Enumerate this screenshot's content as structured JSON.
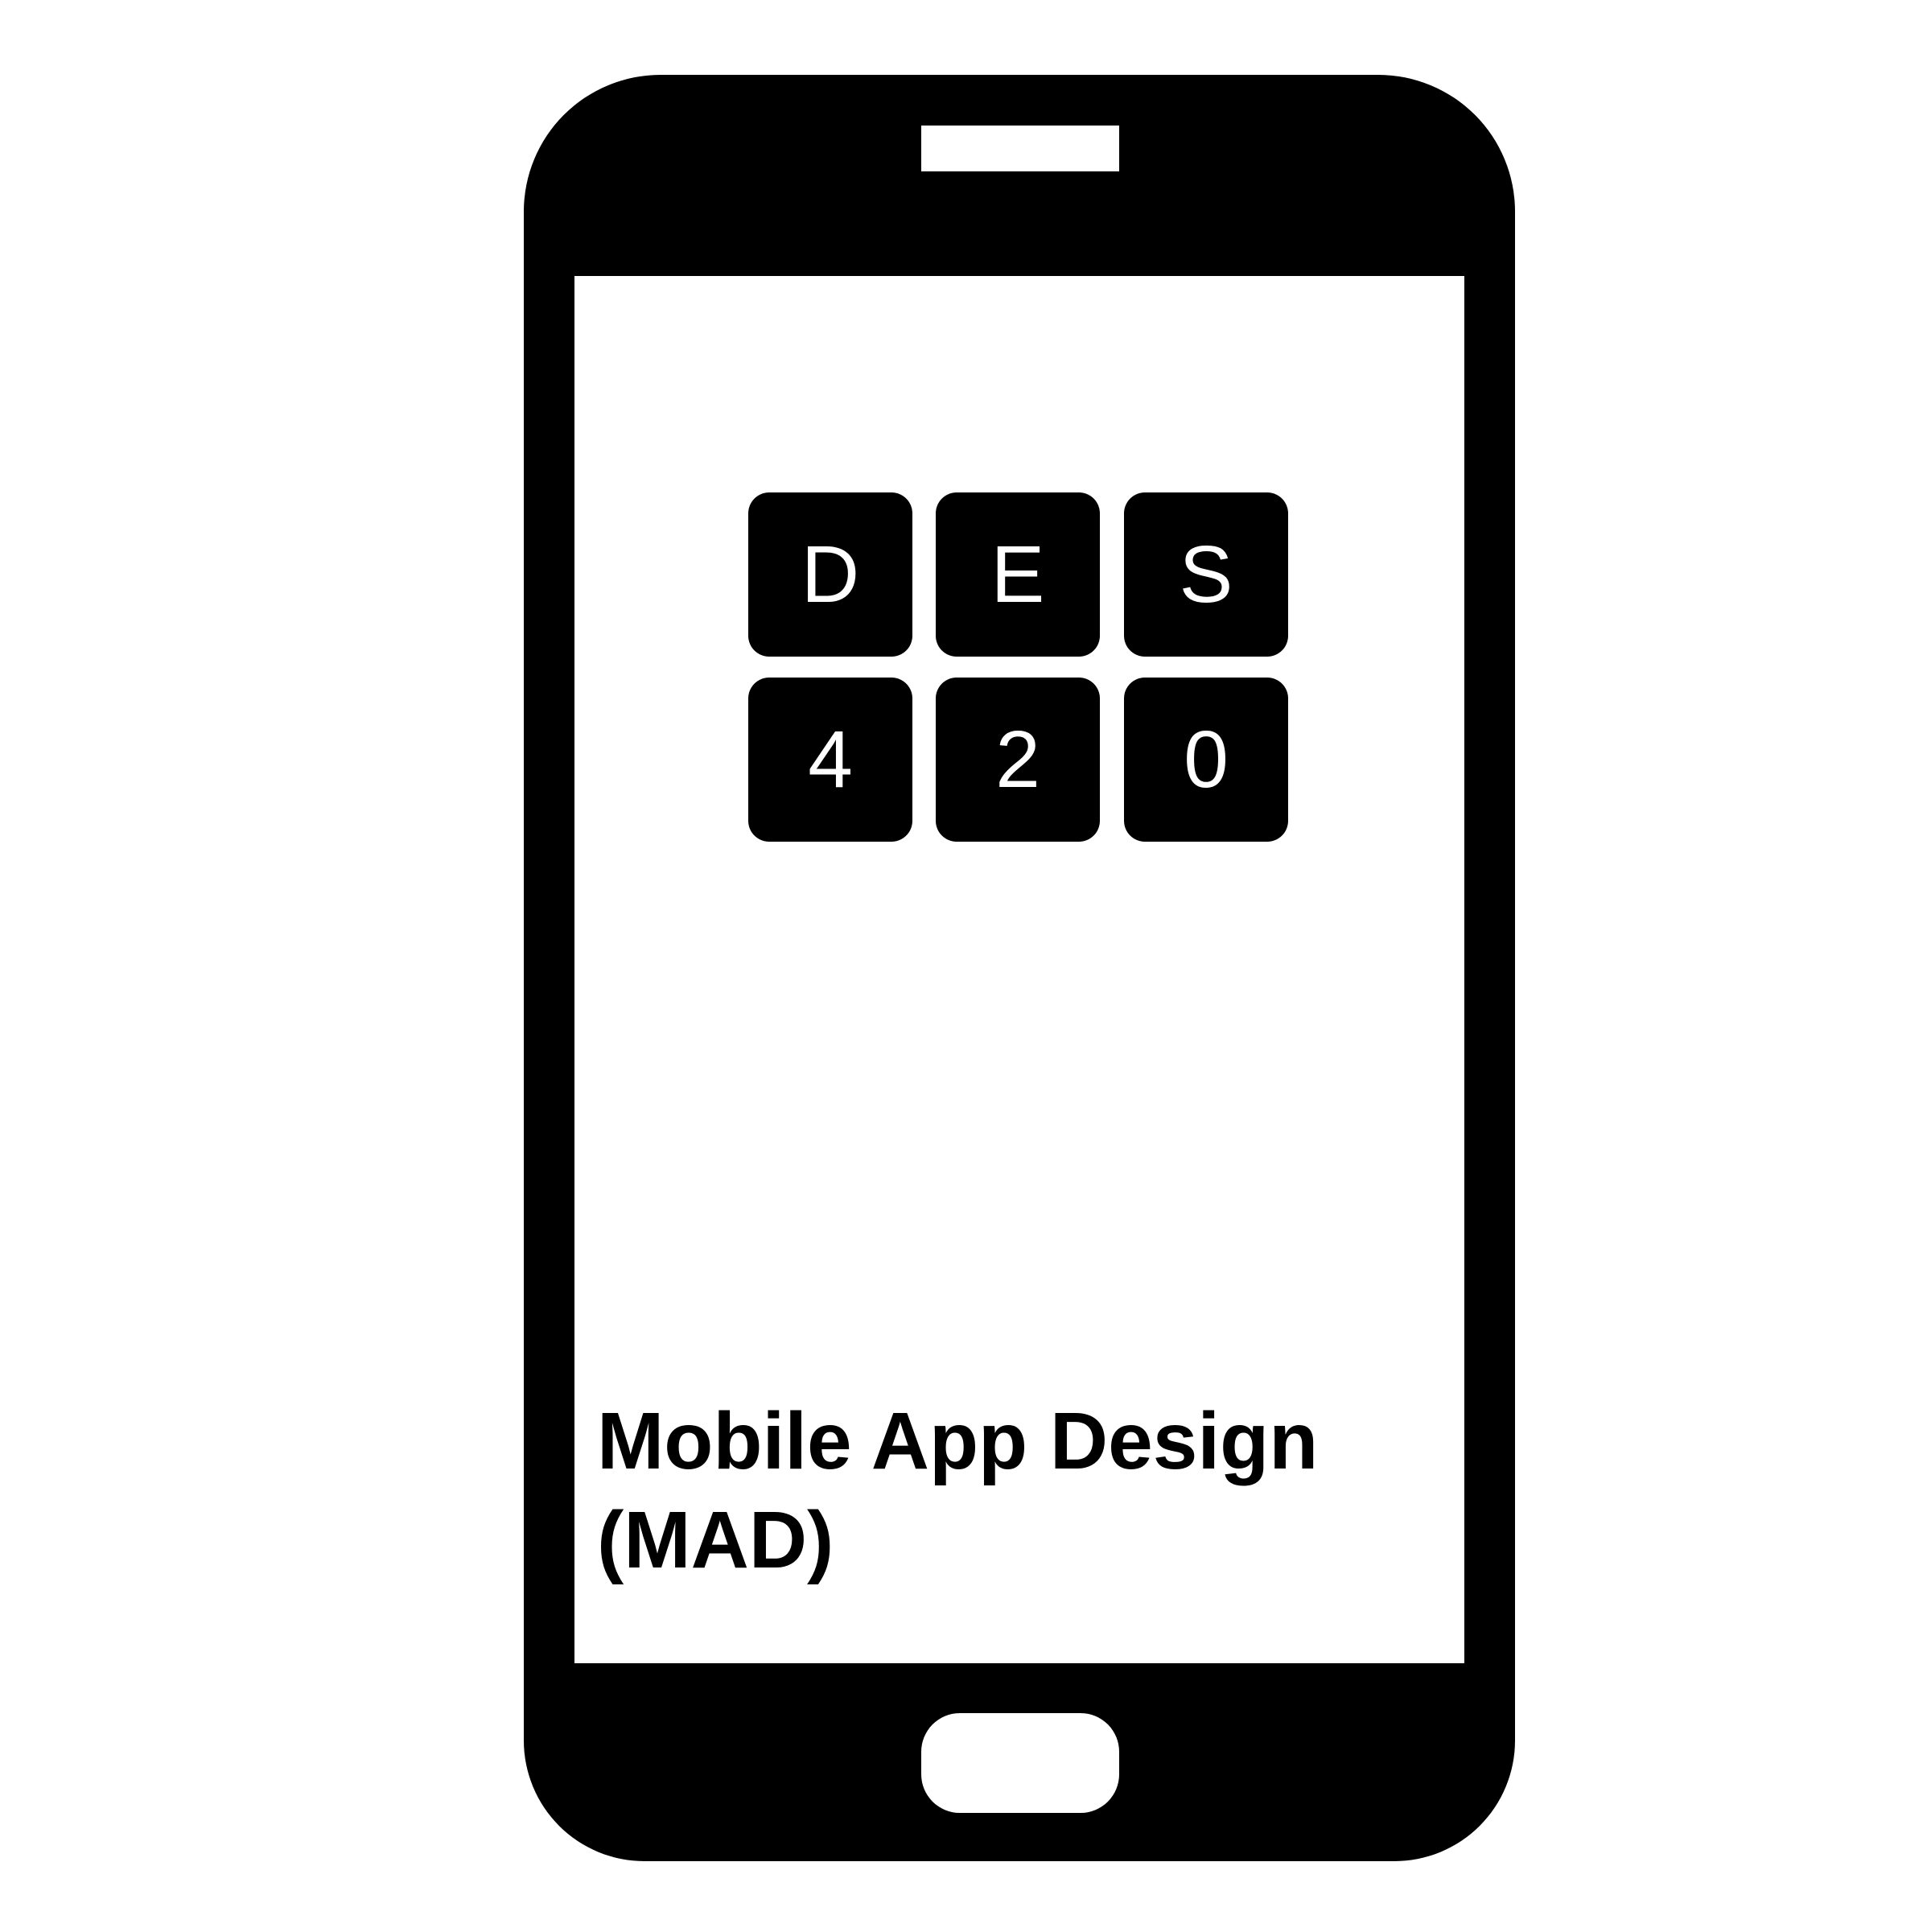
{
  "tiles": {
    "row1": [
      "D",
      "E",
      "S"
    ],
    "row2": [
      "4",
      "2",
      "0"
    ]
  },
  "title": {
    "line1": "Mobile App Design",
    "line2": "(MAD)"
  },
  "colors": {
    "phone_body": "#000000",
    "screen": "#ffffff",
    "tile": "#000000",
    "tile_text": "#ffffff",
    "title_text": "#000000"
  }
}
